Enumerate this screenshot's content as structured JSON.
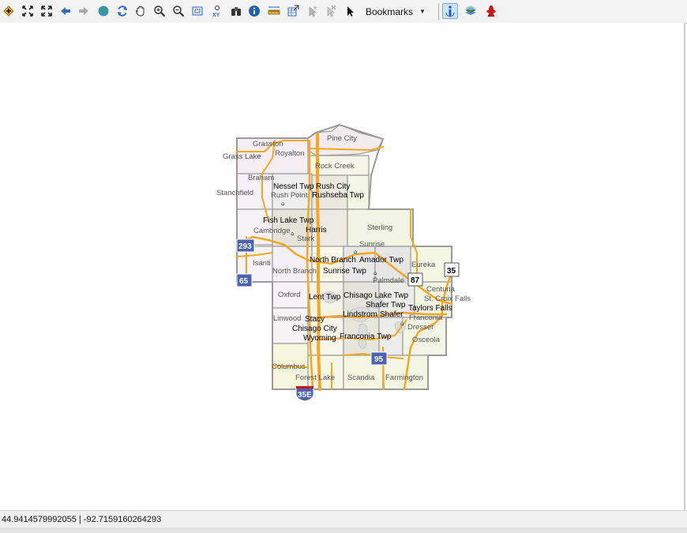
{
  "toolbar": {
    "bookmarks_label": "Bookmarks",
    "xy_label": "XY",
    "buttons": [
      "add-data",
      "full-extent",
      "zoom-to-extent",
      "back",
      "forward",
      "globe",
      "refresh",
      "pan",
      "zoom-in",
      "zoom-out",
      "select-extent",
      "goto-xy",
      "find",
      "identify",
      "measure",
      "export",
      "select-features",
      "clear-selection",
      "select-pointer",
      "bookmarks",
      "map-tips",
      "layers",
      "fire-hydrant"
    ]
  },
  "status": {
    "coordinates": "44.9414579992055 | -92.7159160264293"
  },
  "map": {
    "gray_labels": [
      "Grasston",
      "Royalton",
      "Grass Lake",
      "Pine City",
      "Rock Creek",
      "Braham",
      "Stanchfield",
      "Rush Point",
      "Cambridge",
      "Stark",
      "Sterling",
      "Sunrise",
      "Isanti",
      "North Branch",
      "Eureka",
      "Palmdale",
      "Centuria",
      "St. Croix Falls",
      "Oxford",
      "Linwood",
      "Dresser",
      "Franconia",
      "Osceola",
      "Columbus",
      "Forest Lake",
      "Scandia",
      "Farmington"
    ],
    "black_labels": [
      "Nessel Twp",
      "Rush City",
      "Rushseba Twp",
      "Fish Lake Twp",
      "Harris",
      "North Branch",
      "Amador Twp",
      "Sunrise Twp",
      "Lent Twp",
      "Chisago Lake Twp",
      "Shafer Twp",
      "Taylors Falls",
      "Lindstrom",
      "Shafer",
      "Stacy",
      "Chisago City",
      "Wyoming",
      "Franconia Twp"
    ],
    "shields": {
      "i35e": "35E",
      "us8": "95",
      "mn95": "95",
      "us293": "293",
      "mn65": "65",
      "mn87": "87",
      "wi35": "35"
    }
  },
  "colors": {
    "highway": "#f5a623",
    "boundary": "#9a9a9a",
    "interstate": "#4a62b0",
    "selected": "#cfe3f7"
  }
}
